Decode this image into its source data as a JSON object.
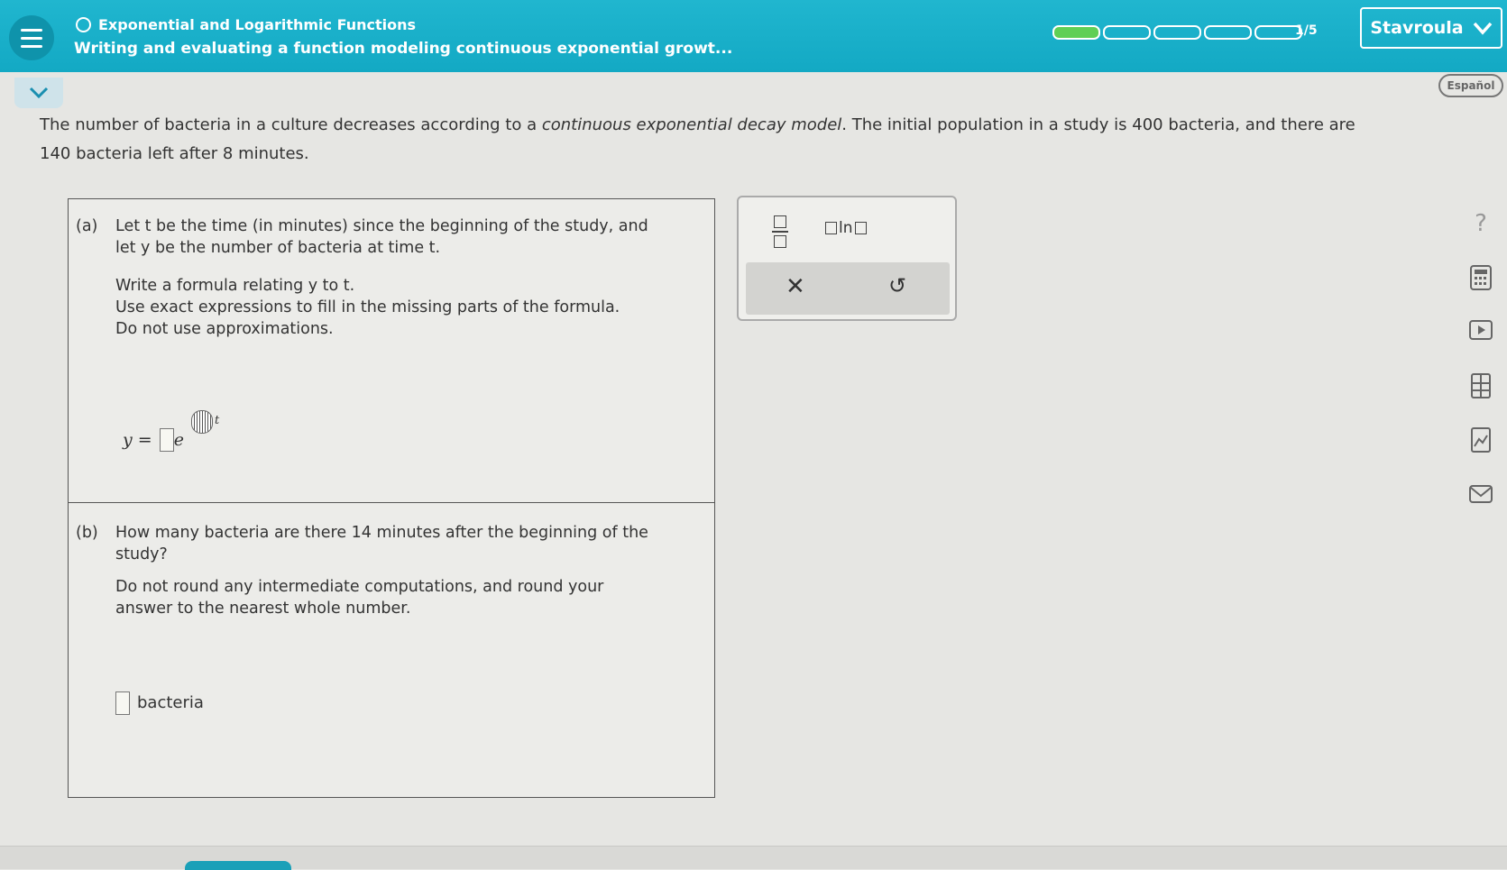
{
  "header": {
    "topic": "Exponential and Logarithmic Functions",
    "subtitle": "Writing and evaluating a function modeling continuous exponential growt...",
    "progress_label": "1/5",
    "progress_completed": 1,
    "progress_total": 5,
    "user_name": "Stavroula"
  },
  "language_button": "Español",
  "problem": {
    "p1": "The number of bacteria in a culture decreases according to a ",
    "p1_italic": "continuous exponential decay model",
    "p2": ". The initial population in a study is 400 bacteria, and there are",
    "p3": "140 bacteria left after 8 minutes."
  },
  "part_a": {
    "label": "(a)",
    "line1": "Let t be the time (in minutes) since the beginning of the study, and",
    "line2": "let y be the number of bacteria at time t.",
    "line3": "Write a formula relating y to t.",
    "line4": "Use exact expressions to fill in the missing parts of the formula.",
    "line5": "Do not use approximations.",
    "formula_lhs": "y =",
    "formula_base": "e",
    "formula_var": "t"
  },
  "part_b": {
    "label": "(b)",
    "line1": "How many bacteria are there 14 minutes after the beginning of the",
    "line2": "study?",
    "line3": "Do not round any intermediate computations, and round your",
    "line4": "answer to the nearest whole number.",
    "unit": "bacteria"
  },
  "toolbox": {
    "ln_label": "ln",
    "clear_symbol": "✕",
    "undo_symbol": "↺"
  },
  "sidebar_icons": [
    "help-icon",
    "calculator-icon",
    "video-icon",
    "textbook-icon",
    "image-icon",
    "message-icon"
  ],
  "colors": {
    "header": "#1aaec8",
    "progress_done": "#5fcf55"
  }
}
